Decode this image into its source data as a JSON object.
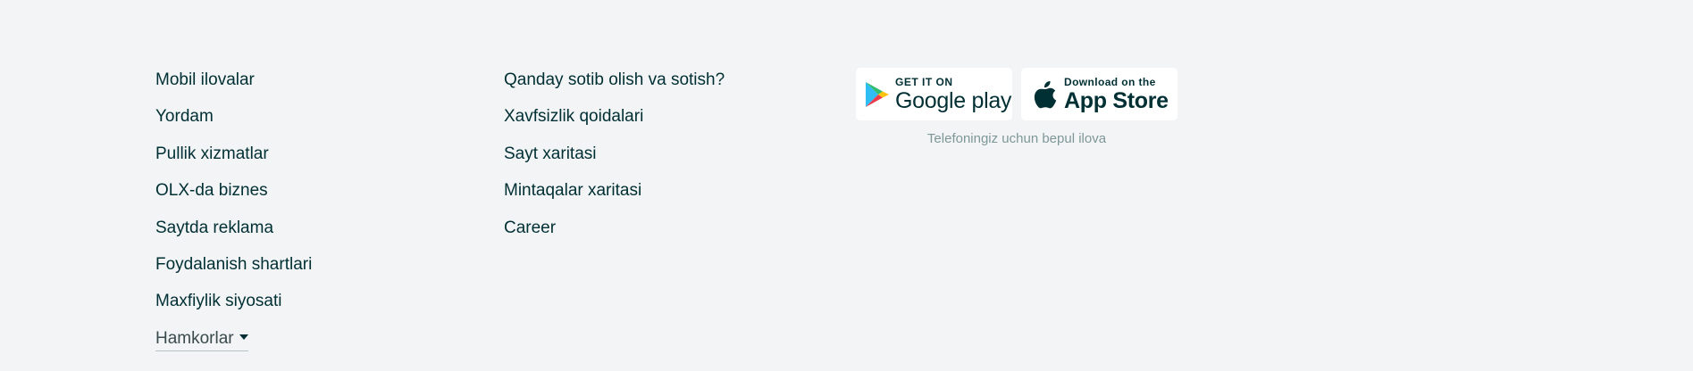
{
  "footer": {
    "column1": [
      {
        "label": "Mobil ilovalar"
      },
      {
        "label": "Yordam"
      },
      {
        "label": "Pullik xizmatlar"
      },
      {
        "label": "OLX-da biznes"
      },
      {
        "label": "Saytda reklama"
      },
      {
        "label": "Foydalanish shartlari"
      },
      {
        "label": "Maxfiylik siyosati"
      }
    ],
    "partners": {
      "label": "Hamkorlar",
      "icon": "caret-down-icon"
    },
    "column2": [
      {
        "label": "Qanday sotib olish va sotish?"
      },
      {
        "label": "Xavfsizlik qoidalari"
      },
      {
        "label": "Sayt xaritasi"
      },
      {
        "label": "Mintaqalar xaritasi"
      },
      {
        "label": "Career"
      }
    ],
    "apps": {
      "google_play": {
        "small": "GET IT ON",
        "big": "Google play",
        "icon": "google-play-icon"
      },
      "app_store": {
        "small": "Download on the",
        "big": "App Store",
        "icon": "apple-icon"
      },
      "tagline": "Telefoningiz uchun bepul ilova"
    }
  },
  "colors": {
    "background": "#f2f4f5",
    "text": "#002f34",
    "muted": "#7f9799",
    "badge_bg": "#ffffff"
  }
}
